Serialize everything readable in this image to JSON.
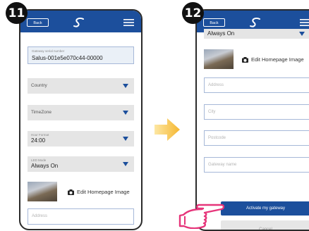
{
  "steps": {
    "left": "11",
    "right": "12"
  },
  "left_screen": {
    "header": {
      "back_label": "Back",
      "logo_icon": "salus-logo-icon",
      "menu_icon": "hamburger-menu-icon"
    },
    "gateway_serial": {
      "label": "Gateway serial number",
      "value": "Salus-001e5e070c44-00000"
    },
    "country": {
      "label": "Country"
    },
    "timezone": {
      "label": "TimeZone"
    },
    "hour_format": {
      "label": "Hour Format",
      "value": "24:00"
    },
    "led_mode": {
      "label": "LED Mode",
      "value": "Always On"
    },
    "edit_image_label": "Edit Homepage Image",
    "address": {
      "placeholder": "Address"
    }
  },
  "right_screen": {
    "header": {
      "back_label": "Back",
      "logo_icon": "salus-logo-icon",
      "menu_icon": "hamburger-menu-icon"
    },
    "led_mode_value": "Always On",
    "edit_image_label": "Edit Homepage Image",
    "address": {
      "placeholder": "Address"
    },
    "city": {
      "placeholder": "City"
    },
    "postcode": {
      "placeholder": "Postcode"
    },
    "gateway_name": {
      "placeholder": "Gateway name"
    },
    "activate_label": "Activate my gateway",
    "cancel_label": "Cancel"
  },
  "colors": {
    "header": "#1c4f9c",
    "accent": "#1c4f9c",
    "arrow": "#f5b731",
    "hand": "#e6357a"
  }
}
